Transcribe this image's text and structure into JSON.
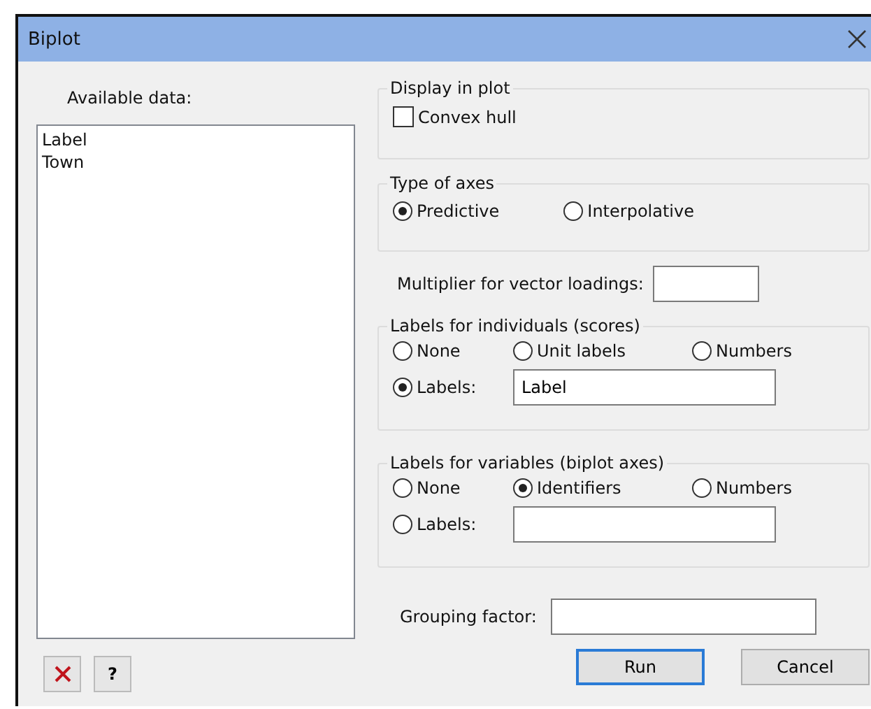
{
  "window": {
    "title": "Biplot"
  },
  "available_data": {
    "label": "Available data:",
    "items": [
      "Label",
      "Town"
    ]
  },
  "display_in_plot": {
    "title": "Display in plot",
    "options": [
      {
        "label": "Convex hull",
        "checked": false
      }
    ]
  },
  "type_of_axes": {
    "title": "Type of axes",
    "options": [
      {
        "label": "Predictive",
        "selected": true
      },
      {
        "label": "Interpolative",
        "selected": false
      }
    ]
  },
  "multiplier": {
    "label": "Multiplier for vector loadings:"
  },
  "labels_for_individuals": {
    "title": "Labels for individuals (scores)",
    "options": [
      {
        "label": "None",
        "selected": false
      },
      {
        "label": "Unit labels",
        "selected": false
      },
      {
        "label": "Numbers",
        "selected": false
      },
      {
        "label": "Labels:",
        "selected": true
      }
    ],
    "field_value": "Label"
  },
  "labels_for_variables": {
    "title": "Labels for variables (biplot axes)",
    "options": [
      {
        "label": "None",
        "selected": false
      },
      {
        "label": "Identifiers",
        "selected": true
      },
      {
        "label": "Numbers",
        "selected": false
      },
      {
        "label": "Labels:",
        "selected": false
      }
    ]
  },
  "grouping_factor": {
    "label": "Grouping factor:"
  },
  "help_button": "?",
  "buttons": [
    {
      "label": "Run",
      "default": true
    },
    {
      "label": "Cancel",
      "default": false
    }
  ]
}
